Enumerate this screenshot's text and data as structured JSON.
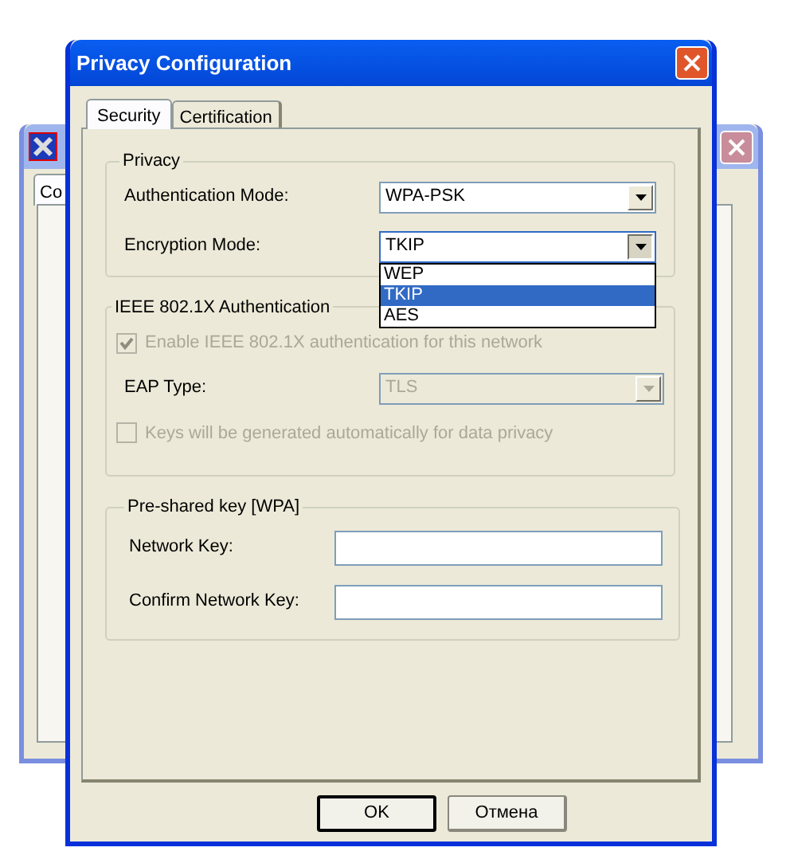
{
  "background_window": {
    "tab_label": "Co"
  },
  "dialog": {
    "title": "Privacy Configuration",
    "tabs": [
      {
        "label": "Security",
        "selected": true
      },
      {
        "label": "Certification",
        "selected": false
      }
    ],
    "privacy": {
      "title": "Privacy",
      "authentication_mode": {
        "label": "Authentication Mode:",
        "value": "WPA-PSK"
      },
      "encryption_mode": {
        "label": "Encryption Mode:",
        "value": "TKIP",
        "expanded": true,
        "options": [
          {
            "label": "WEP",
            "selected": false
          },
          {
            "label": "TKIP",
            "selected": true
          },
          {
            "label": "AES",
            "selected": false
          }
        ]
      }
    },
    "ieee_8021x": {
      "title": "IEEE 802.1X Authentication",
      "enable": {
        "label": "Enable IEEE 802.1X authentication for this network",
        "checked": true,
        "disabled": true
      },
      "eap_type": {
        "label": "EAP Type:",
        "value": "TLS",
        "disabled": true
      },
      "keys_auto": {
        "label": "Keys will be generated automatically for data privacy",
        "checked": false,
        "disabled": true
      }
    },
    "pre_shared_key": {
      "title": "Pre-shared key [WPA]",
      "network_key": {
        "label": "Network Key:"
      },
      "confirm_network_key": {
        "label": "Confirm Network Key:"
      }
    },
    "buttons": [
      {
        "label": "OK",
        "default": true
      },
      {
        "label": "Отмена",
        "default": false
      }
    ]
  }
}
